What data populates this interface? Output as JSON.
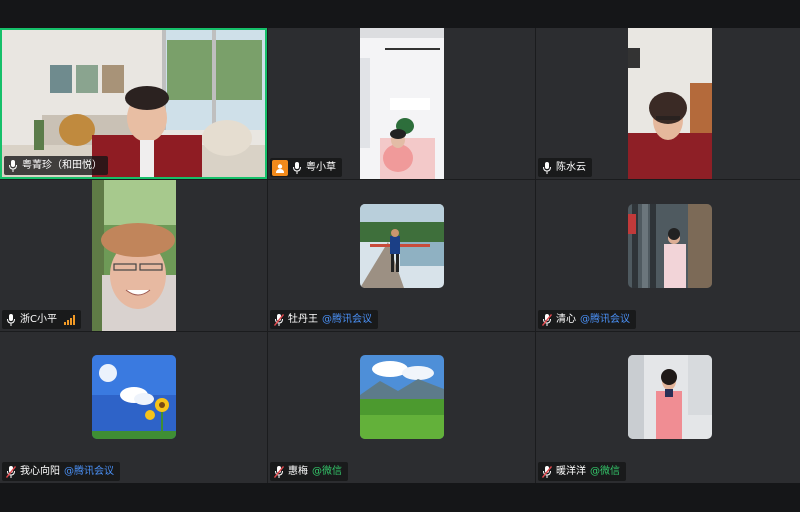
{
  "participants": [
    {
      "name": "粤菁珍（和田悦）",
      "source": "",
      "mic": "on",
      "active": true
    },
    {
      "name": "粤小草",
      "source": "",
      "mic": "on",
      "avatar_badge": true
    },
    {
      "name": "陈水云",
      "source": "",
      "mic": "on"
    },
    {
      "name": "浙C小平",
      "source": "",
      "mic": "on",
      "signal": true
    },
    {
      "name": "牡丹王",
      "source": "@腾讯会议",
      "mic": "muted"
    },
    {
      "name": "清心",
      "source": "@腾讯会议",
      "mic": "muted"
    },
    {
      "name": "我心向阳",
      "source": "@腾讯会议",
      "mic": "muted"
    },
    {
      "name": "惠梅",
      "source": "@微信",
      "mic": "muted"
    },
    {
      "name": "暖洋洋",
      "source": "@微信",
      "mic": "muted"
    }
  ],
  "colors": {
    "active_border": "#16c06a",
    "tencent_source": "#4a90f5",
    "wechat_source": "#34c76a",
    "muted_icon": "#e0484d",
    "signal": "#f29a26"
  }
}
